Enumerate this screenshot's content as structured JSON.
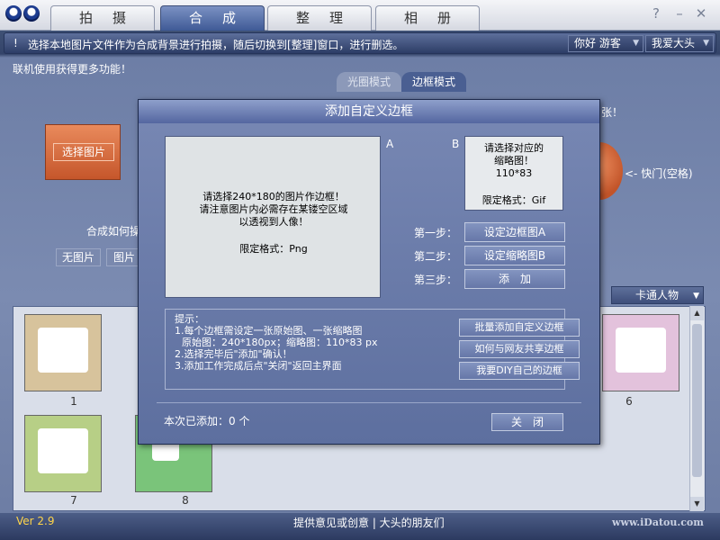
{
  "tabs": [
    "拍摄",
    "合成",
    "整理",
    "相册"
  ],
  "active_tab": 1,
  "window_controls": [
    "?",
    "–",
    "✕"
  ],
  "infobar": {
    "icon": "!",
    "text": "选择本地图片文件作为合成背景进行拍摄，随后切换到[整理]窗口，进行删选。",
    "greeting": "你好 游客",
    "menu": "我爱大头"
  },
  "hint": "联机使用获得更多功能！",
  "mode_tabs": [
    "光圈模式",
    "边框模式"
  ],
  "select_photo": "选择图片",
  "hotkey": "<- 快门(空格)",
  "zhang": "张！",
  "compose_label": "合成如何操",
  "options": [
    "无图片",
    "图片"
  ],
  "category": "卡通人物",
  "thumbnails": [
    {
      "num": "1",
      "color": "#6f5a3c"
    },
    {
      "num": "6",
      "color": "#c04a9a"
    },
    {
      "num": "7",
      "color": "#8aa84f"
    },
    {
      "num": "8",
      "color": "#3f9b3f"
    }
  ],
  "status": {
    "version": "Ver 2.9",
    "feedback": "提供意见或创意 | 大头的朋友们",
    "site": "www.iDatou.com"
  },
  "dialog": {
    "title": "添加自定义边框",
    "label_a": "A",
    "label_b": "B",
    "box_a": {
      "line1": "请选择240*180的图片作边框！",
      "line2": "请注意图片内必需存在某镂空区域",
      "line3": "以透视到人像！",
      "format": "限定格式：Png"
    },
    "box_b": {
      "line1": "请选择对应的",
      "line2": "缩略图！",
      "size": "110*83",
      "format": "限定格式：Gif"
    },
    "steps": [
      {
        "label": "第一步：",
        "button": "设定边框图A"
      },
      {
        "label": "第二步：",
        "button": "设定缩略图B"
      },
      {
        "label": "第三步：",
        "button": "添　加"
      }
    ],
    "tips": {
      "title": "提示：",
      "lines": [
        "1.每个边框需设定一张原始图、一张缩略图",
        "  原始图：240*180px；缩略图：110*83 px",
        "2.选择完毕后\"添加\"确认！",
        "3.添加工作完成后点\"关闭\"返回主界面"
      ],
      "buttons": [
        "批量添加自定义边框",
        "如何与网友共享边框",
        "我要DIY自己的边框"
      ]
    },
    "added": "本次已添加：0 个",
    "close": "关　闭"
  }
}
